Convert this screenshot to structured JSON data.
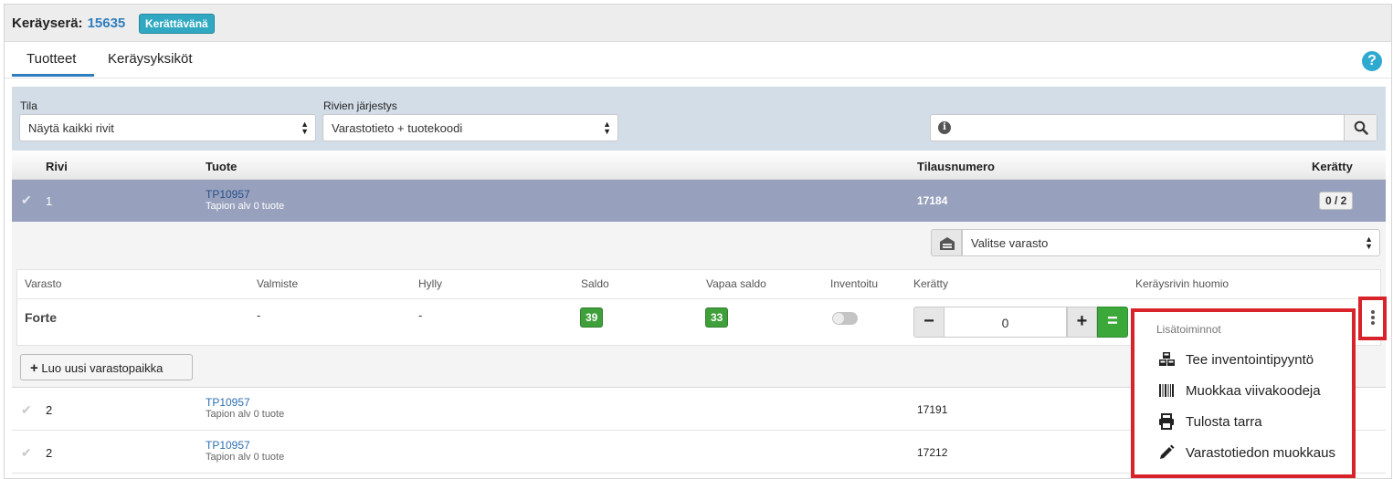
{
  "header": {
    "title_label": "Keräyserä:",
    "batch_number": "15635",
    "status": "Kerättävänä"
  },
  "tabs": [
    {
      "label": "Tuotteet",
      "active": true
    },
    {
      "label": "Keräysyksiköt",
      "active": false
    }
  ],
  "help_icon": "question-icon",
  "filters": {
    "tila": {
      "label": "Tila",
      "value": "Näytä kaikki rivit"
    },
    "order": {
      "label": "Rivien järjestys",
      "value": "Varastotieto + tuotekoodi"
    },
    "search": {
      "value": ""
    }
  },
  "table": {
    "columns": {
      "rivi": "Rivi",
      "tuote": "Tuote",
      "tilausnumero": "Tilausnumero",
      "keratty": "Kerätty"
    },
    "rows": [
      {
        "rivi": "1",
        "code": "TP10957",
        "name": "Tapion alv 0 tuote",
        "order": "17184",
        "collected": "0 / 2",
        "selected": true
      },
      {
        "rivi": "2",
        "code": "TP10957",
        "name": "Tapion alv 0 tuote",
        "order": "17191",
        "collected": ""
      },
      {
        "rivi": "2",
        "code": "TP10957",
        "name": "Tapion alv 0 tuote",
        "order": "17212",
        "collected": ""
      }
    ]
  },
  "detail": {
    "warehouse_select": "Valitse varasto",
    "columns": {
      "varasto": "Varasto",
      "valmiste": "Valmiste",
      "hylly": "Hylly",
      "saldo": "Saldo",
      "vapaa": "Vapaa saldo",
      "inventoitu": "Inventoitu",
      "keratty": "Kerätty",
      "huomio": "Keräysrivin huomio"
    },
    "row": {
      "varasto": "Forte",
      "valmiste": "-",
      "hylly": "-",
      "saldo": "39",
      "vapaa": "33",
      "inventoitu": false,
      "keratty": "0"
    },
    "new_location_button": "Luo uusi varastopaikka"
  },
  "menu": {
    "header": "Lisätoiminnot",
    "items": [
      {
        "label": "Tee inventointipyyntö",
        "icon": "cubes-icon"
      },
      {
        "label": "Muokkaa viivakoodeja",
        "icon": "barcode-icon"
      },
      {
        "label": "Tulosta tarra",
        "icon": "print-icon"
      },
      {
        "label": "Varastotiedon muokkaus",
        "icon": "pencil-icon"
      }
    ]
  },
  "colors": {
    "accent": "#2e7dbe",
    "selected_row": "#97a0bc",
    "highlight": "#d8232a",
    "success": "#3ca83a"
  }
}
